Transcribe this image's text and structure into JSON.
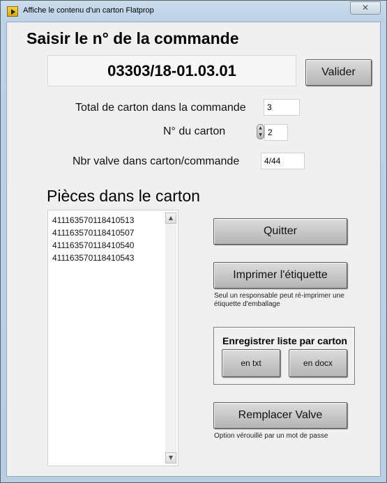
{
  "window": {
    "title": "Affiche le contenu d'un carton Flatprop",
    "close_glyph": "✕",
    "app_icon": "labview-run-icon"
  },
  "order": {
    "heading": "Saisir le n° de la commande",
    "number": "03303/18-01.03.01",
    "validate_label": "Valider"
  },
  "fields": {
    "total_label": "Total de carton dans la commande",
    "total_value": "3",
    "carton_label": "N° du carton",
    "carton_value": "2",
    "valves_label": "Nbr valve dans carton/commande",
    "valves_value": "4/44"
  },
  "pieces": {
    "heading": "Pièces dans le carton",
    "items": [
      "411163570118410513",
      "411163570118410507",
      "411163570118410540",
      "411163570118410543"
    ],
    "scroll_up": "▲",
    "scroll_down": "▼"
  },
  "actions": {
    "quit_label": "Quitter",
    "print_label": "Imprimer l'étiquette",
    "print_note": "Seul un responsable peut ré-imprimer une étiquette d'emballage",
    "save_group_title": "Enregistrer liste par carton",
    "save_txt_label": "en txt",
    "save_docx_label": "en docx",
    "replace_label": "Remplacer Valve",
    "replace_note": "Option vérouillé par un mot de passe"
  },
  "colors": {
    "window_frame": "#b8cee2",
    "panel": "#f0f0f0",
    "button": "#c6c6c6"
  }
}
